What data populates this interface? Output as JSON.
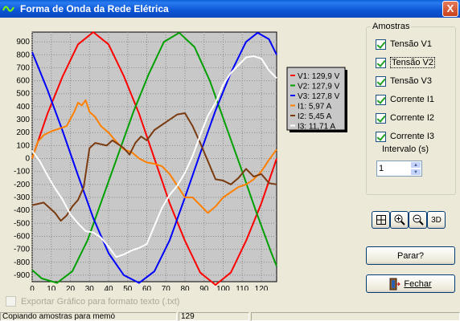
{
  "window": {
    "title": "Forma de Onda da Rede Elétrica",
    "close_label": "X"
  },
  "chart_data": {
    "type": "line",
    "title": "",
    "xlabel": "",
    "ylabel": "",
    "xlim": [
      0,
      128
    ],
    "ylim": [
      -950,
      975
    ],
    "xticks": [
      0,
      10,
      20,
      30,
      40,
      50,
      60,
      70,
      80,
      90,
      100,
      110,
      120
    ],
    "yticks": [
      900,
      800,
      700,
      600,
      500,
      400,
      300,
      200,
      100,
      0,
      -100,
      -200,
      -300,
      -400,
      -500,
      -600,
      -700,
      -800,
      -900
    ],
    "grid": true,
    "legend_position": "top-right",
    "series": [
      {
        "name": "V1: 129,9 V",
        "color": "#ff0000",
        "x": [
          0,
          8,
          16,
          24,
          32,
          40,
          48,
          56,
          64,
          72,
          80,
          88,
          96,
          104,
          112,
          120,
          128
        ],
        "y": [
          0,
          345,
          635,
          880,
          975,
          880,
          635,
          345,
          0,
          -345,
          -635,
          -880,
          -975,
          -880,
          -635,
          -345,
          0
        ]
      },
      {
        "name": "V2: 127,9 V",
        "color": "#00a000",
        "x": [
          0,
          5,
          13,
          21,
          29,
          37,
          45,
          53,
          61,
          69,
          77,
          85,
          93,
          101,
          109,
          117,
          125,
          128
        ],
        "y": [
          -860,
          -925,
          -960,
          -870,
          -630,
          -300,
          30,
          360,
          650,
          900,
          970,
          860,
          600,
          270,
          -60,
          -400,
          -720,
          -830
        ]
      },
      {
        "name": "V3: 127,8 V",
        "color": "#0000ff",
        "x": [
          0,
          8,
          16,
          24,
          32,
          40,
          48,
          56,
          64,
          72,
          80,
          88,
          96,
          104,
          112,
          118,
          124,
          128
        ],
        "y": [
          820,
          530,
          210,
          -130,
          -460,
          -730,
          -900,
          -960,
          -870,
          -630,
          -300,
          40,
          370,
          660,
          900,
          970,
          920,
          800
        ]
      },
      {
        "name": "I1: 5,97 A",
        "color": "#ff8000",
        "x": [
          0,
          3,
          6,
          10,
          14,
          18,
          22,
          24,
          26,
          28,
          30,
          33,
          36,
          40,
          44,
          48,
          52,
          56,
          60,
          64,
          68,
          72,
          76,
          80,
          84,
          88,
          92,
          96,
          100,
          104,
          108,
          112,
          116,
          120,
          124,
          128
        ],
        "y": [
          0,
          130,
          180,
          210,
          230,
          250,
          360,
          430,
          410,
          450,
          360,
          320,
          250,
          200,
          130,
          70,
          50,
          0,
          -30,
          -40,
          -60,
          -120,
          -210,
          -300,
          -300,
          -360,
          -420,
          -370,
          -300,
          -260,
          -220,
          -200,
          -160,
          -100,
          -10,
          70
        ]
      },
      {
        "name": "I2: 5,45 A",
        "color": "#7b3b10",
        "x": [
          0,
          3,
          6,
          9,
          12,
          15,
          18,
          21,
          24,
          27,
          30,
          33,
          36,
          39,
          42,
          45,
          48,
          51,
          54,
          57,
          60,
          64,
          68,
          72,
          76,
          80,
          84,
          88,
          92,
          96,
          100,
          104,
          108,
          112,
          116,
          120,
          124,
          128
        ],
        "y": [
          -360,
          -350,
          -340,
          -380,
          -420,
          -480,
          -440,
          -370,
          -320,
          -220,
          80,
          120,
          110,
          100,
          140,
          110,
          80,
          30,
          120,
          170,
          140,
          220,
          260,
          300,
          340,
          350,
          250,
          120,
          -20,
          -160,
          -170,
          -200,
          -150,
          -80,
          -140,
          -120,
          -190,
          -200
        ]
      },
      {
        "name": "I3: 11,71 A",
        "color": "#ffffff",
        "x": [
          0,
          4,
          8,
          12,
          16,
          20,
          24,
          28,
          32,
          36,
          40,
          44,
          48,
          52,
          56,
          60,
          64,
          68,
          72,
          76,
          80,
          84,
          88,
          92,
          96,
          100,
          104,
          108,
          112,
          116,
          120,
          124,
          128
        ],
        "y": [
          60,
          -20,
          -130,
          -230,
          -320,
          -430,
          -500,
          -560,
          -570,
          -610,
          -680,
          -760,
          -740,
          -710,
          -690,
          -660,
          -520,
          -380,
          -280,
          -210,
          -110,
          20,
          180,
          330,
          430,
          570,
          660,
          720,
          780,
          790,
          770,
          680,
          620
        ]
      }
    ]
  },
  "sidebar": {
    "group_title": "Amostras",
    "checkboxes": [
      {
        "label": "Tensão V1",
        "checked": true
      },
      {
        "label": "Tensão V2",
        "checked": true
      },
      {
        "label": "Tensão V3",
        "checked": true
      },
      {
        "label": "Corrente I1",
        "checked": true
      },
      {
        "label": "Corrente I2",
        "checked": true
      },
      {
        "label": "Corrente I3",
        "checked": true
      }
    ],
    "interval_label": "Intervalo (s)",
    "interval_value": "1",
    "tool_3d_label": "3D",
    "stop_button": "Parar?",
    "close_button": "Fechar"
  },
  "export": {
    "label": "Exportar Gráfico para formato texto (.txt)",
    "checked": false
  },
  "statusbar": {
    "panel1": "Copiando amostras para memó",
    "panel2": "129",
    "panel3": ""
  }
}
